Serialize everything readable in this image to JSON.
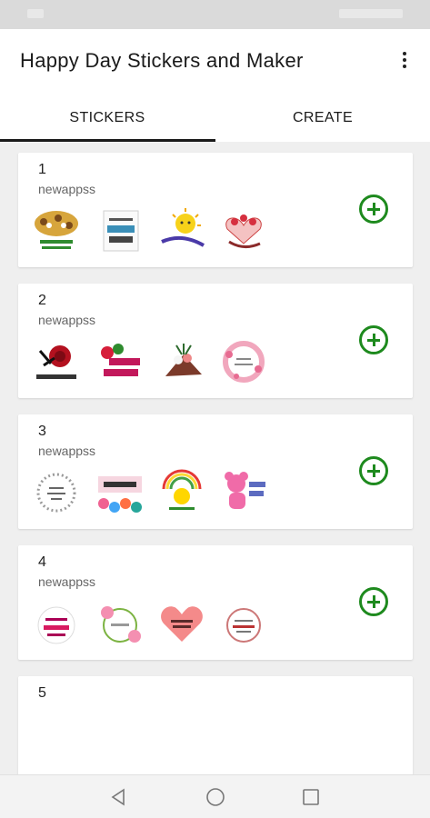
{
  "app": {
    "title": "Happy Day Stickers and Maker"
  },
  "tabs": [
    {
      "label": "STICKERS",
      "selected": true
    },
    {
      "label": "CREATE",
      "selected": false
    }
  ],
  "packs": [
    {
      "number": "1",
      "author": "newappss"
    },
    {
      "number": "2",
      "author": "newappss"
    },
    {
      "number": "3",
      "author": "newappss"
    },
    {
      "number": "4",
      "author": "newappss"
    },
    {
      "number": "5",
      "author": ""
    }
  ],
  "colors": {
    "accent": "#1e8a1e",
    "text": "#1a1a1a",
    "background": "#efefef"
  },
  "icons": {
    "menu": "more-vert-icon",
    "add": "add-circle-icon",
    "back": "back-triangle-icon",
    "home": "home-circle-icon",
    "recents": "recents-square-icon"
  }
}
